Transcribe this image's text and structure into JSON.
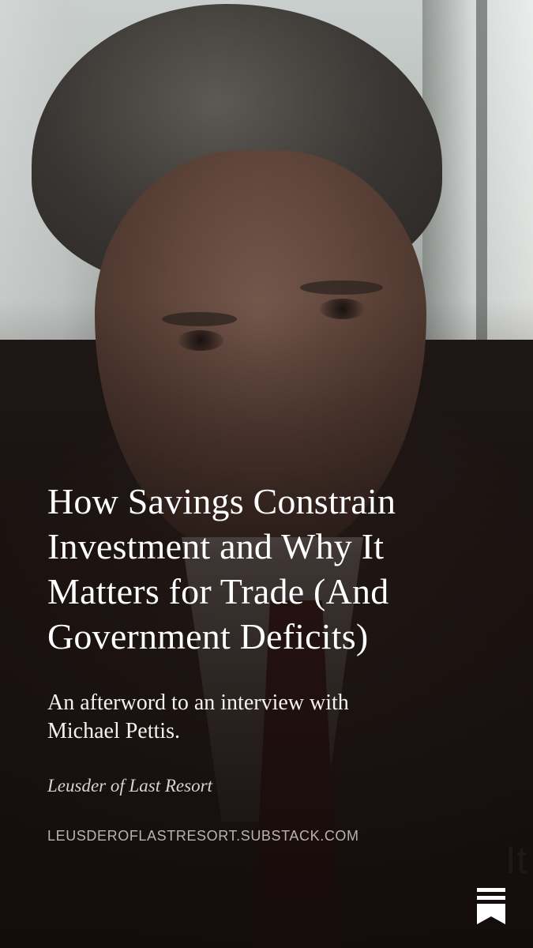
{
  "post": {
    "title": "How Savings Constrain Investment and Why It Matters for Trade (And Government Deficits)",
    "subtitle": "An afterword to an interview with Michael Pettis.",
    "publication": "Leusder of Last Resort",
    "domain": "LEUSDEROFLASTRESORT.SUBSTACK.COM"
  },
  "background": {
    "watermark_fragment": "It",
    "description_tone": "dark"
  },
  "branding": {
    "logo_icon": "substack-logo-icon",
    "logo_color": "#ffffff"
  }
}
